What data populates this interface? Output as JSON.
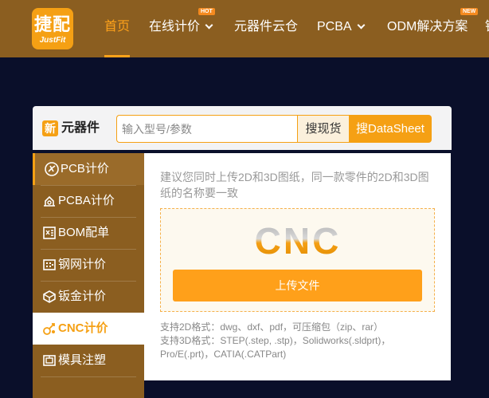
{
  "header": {
    "logo_cn": "捷配",
    "logo_en": "JustFit",
    "nav": [
      {
        "label": "首页",
        "active": true
      },
      {
        "label": "在线计价",
        "badge": "HOT",
        "dropdown": true
      },
      {
        "label": "元器件云仓"
      },
      {
        "label": "PCBA",
        "dropdown": true
      },
      {
        "label": "ODM解决方案",
        "badge": "NEW"
      },
      {
        "label": "钢"
      }
    ]
  },
  "search": {
    "icon_char": "新",
    "label": "元器件",
    "placeholder": "输入型号/参数",
    "stock_button": "搜现货",
    "datasheet_button": "搜DataSheet"
  },
  "sidebar": {
    "items": [
      {
        "label": "PCB计价",
        "icon": "pcb-icon"
      },
      {
        "label": "PCBA计价",
        "icon": "pcba-icon"
      },
      {
        "label": "BOM配单",
        "icon": "bom-icon"
      },
      {
        "label": "钢网计价",
        "icon": "stencil-icon"
      },
      {
        "label": "钣金计价",
        "icon": "sheet-metal-icon"
      },
      {
        "label": "CNC计价",
        "icon": "cnc-icon",
        "active": true
      },
      {
        "label": "模具注塑",
        "icon": "mold-icon"
      }
    ]
  },
  "main": {
    "hint": "建议您同时上传2D和3D图纸，同一款零件的2D和3D图纸的名称要一致",
    "logo_text": "CNC",
    "upload_button": "上传文件",
    "formats_2d": "支持2D格式：dwg、dxf、pdf，可压缩包（zip、rar）",
    "formats_3d": "支持3D格式：STEP(.step, .stp)，Solidworks(.sldprt)，Pro/E(.prt)，CATIA(.CATPart)"
  },
  "colors": {
    "brand_brown": "#8b5e20",
    "accent_orange": "#f5a014",
    "page_bg": "#0a0f2a"
  }
}
